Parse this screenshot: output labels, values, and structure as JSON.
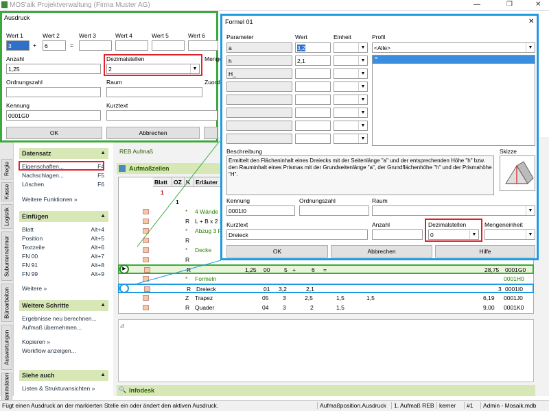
{
  "app_title": "MOS'aik Projektverwaltung (Firma Muster AG)",
  "nav_tabs": [
    "Stammdaten",
    "Auswertungen",
    "Büroarbeiten",
    "Subunternehmer",
    "Logistik",
    "Kasse",
    "Regie"
  ],
  "datensatz": {
    "title": "Datensatz",
    "items": [
      {
        "label": "Eigenschaften...",
        "key": "F4"
      },
      {
        "label": "Nachschlagen...",
        "key": "F5"
      },
      {
        "label": "Löschen",
        "key": "F6"
      },
      {
        "label": "Weitere Funktionen »",
        "key": ""
      }
    ]
  },
  "einfuegen": {
    "title": "Einfügen",
    "items": [
      {
        "label": "Blatt",
        "key": "Alt+4"
      },
      {
        "label": "Position",
        "key": "Alt+5"
      },
      {
        "label": "Textzeile",
        "key": "Alt+6"
      },
      {
        "label": "FN 00",
        "key": "Alt+7"
      },
      {
        "label": "FN 91",
        "key": "Alt+8"
      },
      {
        "label": "FN 99",
        "key": "Alt+9"
      },
      {
        "label": "Weitere »",
        "key": ""
      }
    ]
  },
  "weitere": {
    "title": "Weitere Schritte",
    "items": [
      "Ergebnisse neu berechnen...",
      "Aufmaß übernehmen...",
      "Kopieren »",
      "Workflow anzeigen..."
    ]
  },
  "siehe": {
    "title": "Siehe auch",
    "items": [
      "Listen & Strukturansichten »"
    ]
  },
  "reb_label": "REB Aufmaß",
  "aufmass_title": "Aufmaßzeilen",
  "infodesk_title": "Infodesk",
  "grid_headers": [
    "Blatt",
    "OZ",
    "K",
    "Erläuter"
  ],
  "rows": [
    {
      "c": [
        "1",
        "",
        "",
        "",
        ""
      ]
    },
    {
      "c": [
        "",
        "1",
        "",
        "",
        ""
      ]
    },
    {
      "c": [
        "",
        "",
        "*",
        "4 Wände",
        ""
      ]
    },
    {
      "c": [
        "",
        "",
        "R",
        "L + B x 2 x",
        ""
      ]
    },
    {
      "c": [
        "",
        "",
        "*",
        "Abzug 3 F",
        ""
      ]
    },
    {
      "c": [
        "",
        "",
        "R",
        "",
        ""
      ]
    },
    {
      "c": [
        "",
        "",
        "*",
        "Decke",
        ""
      ]
    },
    {
      "c": [
        "",
        "",
        "R",
        "",
        ""
      ]
    },
    {
      "c": [
        "",
        "",
        "R",
        "",
        "1,25",
        "00",
        "5",
        "+",
        "6",
        "=",
        "28,75",
        "0001G0"
      ]
    },
    {
      "c": [
        "",
        "",
        "*",
        "Formeln",
        "0001H0"
      ]
    },
    {
      "c": [
        "",
        "",
        "R",
        "Dreieck",
        "01",
        "3,2",
        "2,1",
        "3",
        "0001I0"
      ]
    },
    {
      "c": [
        "",
        "",
        "Z",
        "Trapez",
        "05",
        "3",
        "2,5",
        "1,5",
        "1,5",
        "6,19",
        "0001J0"
      ]
    },
    {
      "c": [
        "",
        "",
        "R",
        "Quader",
        "04",
        "3",
        "2",
        "1,5",
        "9,00",
        "0001K0"
      ]
    }
  ],
  "ausdruck": {
    "title": "Ausdruck",
    "wert_labels": [
      "Wert 1",
      "Wert 2",
      "Wert 3",
      "Wert 4",
      "Wert 5",
      "Wert 6"
    ],
    "wert_values": [
      "3",
      "6"
    ],
    "ops": [
      "+",
      "="
    ],
    "anzahl_label": "Anzahl",
    "anzahl_value": "1,25",
    "dezimal_label": "Dezimalstellen",
    "dezimal_value": "2",
    "menge_label": "Menge",
    "ordnung_label": "Ordnungszahl",
    "raum_label": "Raum",
    "zuord_label": "Zuordn",
    "kennung_label": "Kennung",
    "kennung_value": "0001G0",
    "kurztext_label": "Kurztext",
    "ok": "OK",
    "cancel": "Abbrechen"
  },
  "formel": {
    "title": "Formel 01",
    "col_param": "Parameter",
    "col_wert": "Wert",
    "col_einheit": "Einheit",
    "col_profil": "Profil",
    "params": [
      {
        "p": "a",
        "w": "3,2"
      },
      {
        "p": "h",
        "w": "2,1"
      },
      {
        "p": "H_",
        "w": ""
      }
    ],
    "profil_value": "<Alle>",
    "beschreibung_label": "Beschreibung",
    "beschreibung": "Ermittelt den Flächeninhalt eines Dreiecks mit der Seitenlänge \"a\" und der entsprechenden Höhe \"h\" bzw. den Rauminhalt eines Prismas mit der Grundseitenlänge \"a\", der Grundflächenhöhe \"h\" und der Prismahöhe \"H\".",
    "skizze_label": "Skizze",
    "kennung_label": "Kennung",
    "kennung_value": "0001I0",
    "ordnung_label": "Ordnungszahl",
    "raum_label": "Raum",
    "kurztext_label": "Kurztext",
    "kurztext_value": "Dreieck",
    "anzahl_label": "Anzahl",
    "dezimal_label": "Dezimalstellen",
    "dezimal_value": "0",
    "menge_label": "Mengeneinheit",
    "ok": "OK",
    "cancel": "Abbrechen",
    "help": "Hilfe"
  },
  "status": [
    "Fügt einen Ausdruck an der markierten Stelle ein oder ändert den aktiven Ausdruck.",
    "Aufmaßposition.Ausdruck",
    "1. Aufmaß REB",
    "kerner",
    "#1",
    "Admin - Mosaik.mdb"
  ]
}
